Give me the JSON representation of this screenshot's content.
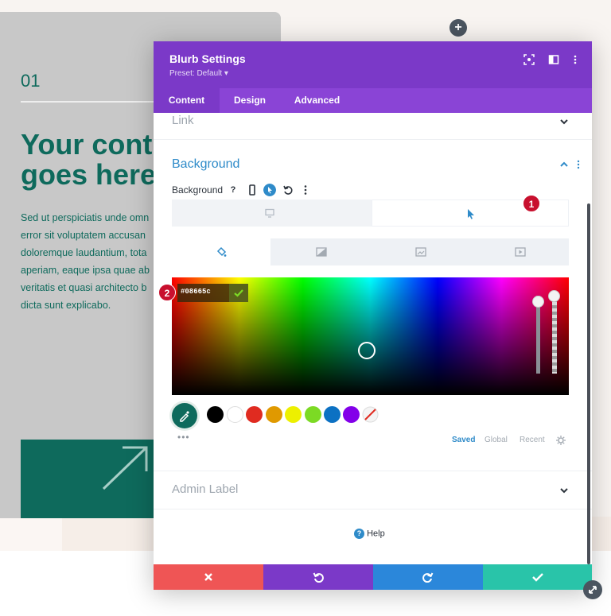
{
  "page": {
    "card": {
      "number": "01",
      "heading_line1": "Your cont",
      "heading_line2": "goes here",
      "body": [
        "Sed ut perspiciatis unde omn",
        "error sit voluptatem accusan",
        "doloremque laudantium, tota",
        "aperiam, eaque ipsa quae ab",
        "veritatis et quasi architecto b",
        "dicta sunt explicabo."
      ]
    },
    "add_icon": "plus-icon"
  },
  "modal": {
    "title": "Blurb Settings",
    "preset": "Preset: Default ▾",
    "header_icons": [
      "focus-icon",
      "split-view-icon",
      "more-icon"
    ],
    "tabs": [
      {
        "label": "Content",
        "active": true
      },
      {
        "label": "Design",
        "active": false
      },
      {
        "label": "Advanced",
        "active": false
      }
    ],
    "sections": {
      "link": "Link",
      "background": "Background",
      "admin_label": "Admin Label"
    },
    "background_row": {
      "label": "Background",
      "icons": [
        "help-icon",
        "phone-icon",
        "hover-cursor-icon",
        "reset-icon",
        "more-icon"
      ]
    },
    "device_tabs": [
      "desktop-icon",
      "hover-cursor-icon"
    ],
    "type_tabs": [
      "paint-bucket-icon",
      "gradient-icon",
      "image-icon",
      "video-icon"
    ],
    "badges": {
      "one": "1",
      "two": "2"
    },
    "color": {
      "hex": "#08665c",
      "swatches": [
        "#000000",
        "#ffffff",
        "#e02b20",
        "#e09900",
        "#edf000",
        "#7cda24",
        "#0c71c3",
        "#8300e9"
      ],
      "tabs": [
        {
          "label": "Saved",
          "active": true
        },
        {
          "label": "Global",
          "active": false
        },
        {
          "label": "Recent",
          "active": false
        }
      ],
      "dots": "•••"
    },
    "help": "Help",
    "footer": {
      "cancel_color": "#ef5555",
      "undo_color": "#7b39c8",
      "redo_color": "#2b87da",
      "save_color": "#29c4a9"
    }
  }
}
